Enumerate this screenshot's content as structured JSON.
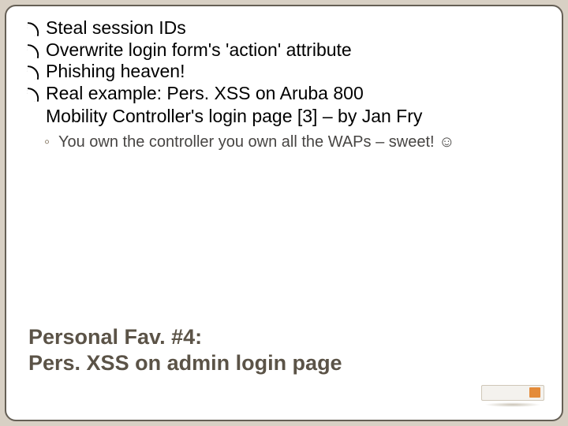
{
  "bullets": [
    "Steal session IDs",
    "Overwrite login form's 'action' attribute",
    "Phishing heaven!",
    "Real example: Pers. XSS on Aruba 800"
  ],
  "bullet4_cont": "Mobility Controller's login page [3] – by Jan Fry",
  "sub_point": "You own the controller you own all the WAPs – sweet! ☺",
  "title_line1": "Personal Fav. #4:",
  "title_line2": "Pers. XSS on admin login page"
}
